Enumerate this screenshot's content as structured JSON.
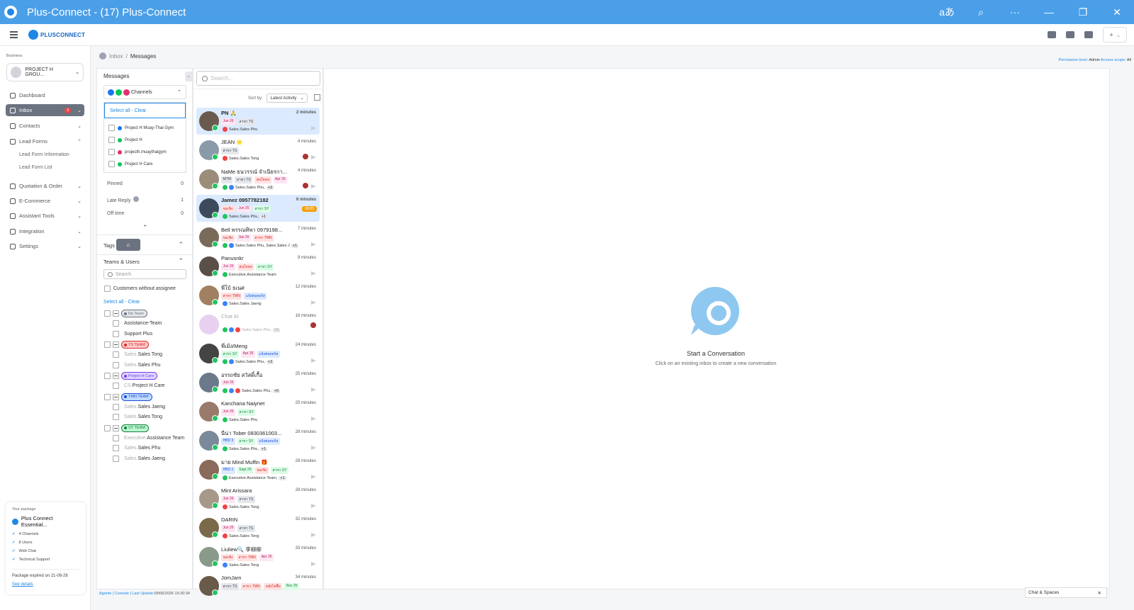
{
  "window": {
    "title": "Plus-Connect - (17) Plus-Connect",
    "controls": [
      "aあ",
      "⌕",
      "···",
      "—",
      "❐",
      "✕"
    ]
  },
  "brand": "PLUSCONNECT",
  "sidebar": {
    "business_label": "Business",
    "business": "PROJECT H GROU...",
    "nav": [
      {
        "label": "Dashboard",
        "icon": "dashboard-icon"
      },
      {
        "label": "Inbox",
        "badge": "3",
        "active": true,
        "icon": "inbox-icon"
      },
      {
        "label": "Contacts",
        "icon": "contacts-icon"
      },
      {
        "label": "Lead Forms",
        "icon": "lead-forms-icon"
      },
      {
        "label": "Quotation & Order",
        "icon": "quotation-icon"
      },
      {
        "label": "E-Commerce",
        "icon": "cart-icon"
      },
      {
        "label": "Assistant Tools",
        "icon": "assistant-icon"
      },
      {
        "label": "Integration",
        "icon": "integration-icon"
      },
      {
        "label": "Settings",
        "icon": "settings-icon"
      }
    ],
    "lead_forms_sub": [
      "Lead Form Information",
      "Lead Form List"
    ],
    "package": {
      "title": "Your package",
      "name": "Plus Connect Essential...",
      "features": [
        "4 Channels",
        "8 Users",
        "Web Chat",
        "Technical Support"
      ],
      "expiry": "Package expired on 21-08-26",
      "link": "See details"
    }
  },
  "breadcrumb": {
    "root": "Inbox",
    "current": "Messages"
  },
  "permission": {
    "label1": "Permission level:",
    "value1": "Admin",
    "label2": "Access scope:",
    "value2": "All"
  },
  "filters": {
    "title": "Messages",
    "channels_label": "Channels",
    "select_all": "Select all - Clear",
    "channels": [
      {
        "name": "Project H Muay-Thai Gym",
        "color": "#1877f2"
      },
      {
        "name": "Project H",
        "color": "#06c755"
      },
      {
        "name": "projecth.muaythaigym",
        "color": "#e1306c"
      },
      {
        "name": "Project H Care",
        "color": "#06c755"
      }
    ],
    "stats": [
      {
        "label": "Pinned",
        "value": "0"
      },
      {
        "label": "Late Reply",
        "value": "1"
      },
      {
        "label": "Off time",
        "value": "0"
      }
    ],
    "tags_label": "Tags",
    "teams_label": "Teams & Users",
    "search_placeholder": "Search",
    "without_assignee": "Customers without assignee",
    "select_all2": "Select all - Clear",
    "teams": [
      {
        "team": "No Team",
        "color": "#6b7280",
        "bg": "#e5e7eb",
        "users": [
          {
            "p": "",
            "n": "Assistance-Team"
          },
          {
            "p": "",
            "n": "Support Plus"
          }
        ]
      },
      {
        "team": "TS TEAM",
        "color": "#dc2626",
        "bg": "#fecaca",
        "users": [
          {
            "p": "Sales.",
            "n": "Sales Tong"
          },
          {
            "p": "Sales.",
            "n": "Sales Phu"
          }
        ]
      },
      {
        "team": "Project H Care",
        "color": "#7c3aed",
        "bg": "#ddd6fe",
        "users": [
          {
            "p": "CS.",
            "n": "Project H Care"
          }
        ]
      },
      {
        "team": "TMN TEAM",
        "color": "#1d4ed8",
        "bg": "#bfdbfe",
        "users": [
          {
            "p": "Sales.",
            "n": "Sales Jaeng"
          },
          {
            "p": "Sales.",
            "n": "Sales Tong"
          }
        ]
      },
      {
        "team": "SY TEAM",
        "color": "#15803d",
        "bg": "#bbf7d0",
        "users": [
          {
            "p": "Executive.",
            "n": "Assistance Team"
          },
          {
            "p": "Sales.",
            "n": "Sales Phu"
          },
          {
            "p": "Sales.",
            "n": "Sales Jaeng"
          }
        ]
      }
    ]
  },
  "list": {
    "search_placeholder": "Search...",
    "sort_label": "Sort by:",
    "sort_value": "Latest Activity",
    "conversations": [
      {
        "name": "PN 🙏",
        "time": "2 minutes",
        "tags": [
          [
            "Jun 26",
            "#fce7f3",
            "#be185d"
          ],
          [
            "สาขา TS",
            "#e5e7eb",
            "#374151"
          ]
        ],
        "assignee": "Sales.Sales Phu",
        "dots": [
          "#ef4444"
        ],
        "hl": true,
        "bold": true
      },
      {
        "name": "JEAN 🌟",
        "time": "4 minutes",
        "tags": [
          [
            "สาขา TS",
            "#e5e7eb",
            "#374151"
          ]
        ],
        "assignee": "Sales.Sales Tong",
        "dots": [
          "#ef4444"
        ],
        "uav": true
      },
      {
        "name": "NaMe ธนวรรณ์ จำเนียรกา...",
        "time": "4 minutes",
        "tags": [
          [
            "MTM",
            "#e5e7eb",
            "#374151"
          ],
          [
            "สาขา TS",
            "#e5e7eb",
            "#374151"
          ],
          [
            "สนใจคล",
            "#fee2e2",
            "#dc2626"
          ],
          [
            "Apr 26",
            "#fce7f3",
            "#be185d"
          ]
        ],
        "assignee": "Sales.Sales Phu,",
        "more": "+3",
        "dots": [
          "#22c55e",
          "#3b82f6"
        ],
        "uav": true
      },
      {
        "name": "Jamez 0957782182",
        "time": "6 minutes",
        "tags": [
          [
            "ขอเชิง",
            "#fee2e2",
            "#dc2626"
          ],
          [
            "Jun 26",
            "#fce7f3",
            "#be185d"
          ],
          [
            "สาขา SY",
            "#dcfce7",
            "#15803d"
          ]
        ],
        "assignee": "Sales.Sales Phu,",
        "more": "+1",
        "dots": [
          "#22c55e"
        ],
        "hl": true,
        "bold": true,
        "late": "00:05"
      },
      {
        "name": "Bell พรรณทิพา 0979198...",
        "time": "7 minutes",
        "tags": [
          [
            "ขอเชิง",
            "#fee2e2",
            "#dc2626"
          ],
          [
            "Jan 26",
            "#fce7f3",
            "#be185d"
          ],
          [
            "สาขา TMN",
            "#fee2e2",
            "#dc2626"
          ]
        ],
        "assignee": "Sales.Sales Phu, Sales.Sales J",
        "more": "+1",
        "dots": [
          "#22c55e",
          "#3b82f6"
        ]
      },
      {
        "name": "Panusnkr",
        "time": "9 minutes",
        "tags": [
          [
            "Jun 26",
            "#fce7f3",
            "#be185d"
          ],
          [
            "สนใจคล",
            "#fee2e2",
            "#dc2626"
          ],
          [
            "สาขา SY",
            "#dcfce7",
            "#15803d"
          ]
        ],
        "assignee": "Executive.Assistance Team",
        "dots": [
          "#22c55e"
        ]
      },
      {
        "name": "พี่โบ้ ธเนศ",
        "time": "12 minutes",
        "tags": [
          [
            "สาขา TMN",
            "#fee2e2",
            "#dc2626"
          ],
          [
            "แจ้งต่อคอร์ส",
            "#dbeafe",
            "#1d4ed8"
          ]
        ],
        "assignee": "Sales.Sales Jaeng",
        "dots": [
          "#3b82f6"
        ]
      },
      {
        "name": "Chat AI",
        "time": "16 minutes",
        "tags": [],
        "assignee": "Sales.Sales Phu,",
        "more": "+5",
        "dots": [
          "#22c55e",
          "#3b82f6",
          "#ef4444"
        ],
        "dim": true,
        "uav": true
      },
      {
        "name": "พี่เม้ง/Meng",
        "time": "24 minutes",
        "tags": [
          [
            "สาขา SY",
            "#dcfce7",
            "#15803d"
          ],
          [
            "Apr 26",
            "#fce7f3",
            "#be185d"
          ],
          [
            "แจ้งต่อคอร์ส",
            "#dbeafe",
            "#1d4ed8"
          ]
        ],
        "assignee": "Sales.Sales Phu,",
        "more": "+3",
        "dots": [
          "#22c55e",
          "#3b82f6"
        ]
      },
      {
        "name": "อรรถชัย สวัสดิ์เกื้อ",
        "time": "25 minutes",
        "tags": [
          [
            "Jun 26",
            "#fce7f3",
            "#be185d"
          ]
        ],
        "assignee": "Sales.Sales Phu,",
        "more": "+5",
        "dots": [
          "#22c55e",
          "#3b82f6",
          "#ef4444"
        ]
      },
      {
        "name": "Kanchana Naiynet",
        "time": "25 minutes",
        "tags": [
          [
            "Jun 26",
            "#fce7f3",
            "#be185d"
          ],
          [
            "สาขา SY",
            "#dcfce7",
            "#15803d"
          ]
        ],
        "assignee": "Sales.Sales Phu",
        "dots": [
          "#22c55e"
        ]
      },
      {
        "name": "นีน่า Tober 0830361003...",
        "time": "28 minutes",
        "tags": [
          [
            "HBD 3",
            "#dbeafe",
            "#1d4ed8"
          ],
          [
            "สาขา SY",
            "#dcfce7",
            "#15803d"
          ],
          [
            "แจ้งต่อคอร์ส",
            "#dbeafe",
            "#1d4ed8"
          ]
        ],
        "assignee": "Sales.Sales Phu,",
        "more": "+1",
        "dots": [
          "#22c55e"
        ]
      },
      {
        "name": "มาย Mind Muffin 🎁",
        "time": "28 minutes",
        "tags": [
          [
            "HBD 1",
            "#dbeafe",
            "#1d4ed8"
          ],
          [
            "Sept 25",
            "#dcfce7",
            "#15803d"
          ],
          [
            "ขอเชิง",
            "#fee2e2",
            "#dc2626"
          ],
          [
            "สาขา SY",
            "#dcfce7",
            "#15803d"
          ]
        ],
        "assignee": "Executive.Assistance Team,",
        "more": "+1",
        "dots": [
          "#22c55e"
        ]
      },
      {
        "name": "Mint Arissara",
        "time": "28 minutes",
        "tags": [
          [
            "Jun 26",
            "#fce7f3",
            "#be185d"
          ],
          [
            "สาขา TS",
            "#e5e7eb",
            "#374151"
          ]
        ],
        "assignee": "Sales.Sales Tong",
        "dots": [
          "#ef4444"
        ]
      },
      {
        "name": "DARIN",
        "time": "32 minutes",
        "tags": [
          [
            "Jun 26",
            "#fce7f3",
            "#be185d"
          ],
          [
            "สาขา TS",
            "#e5e7eb",
            "#374151"
          ]
        ],
        "assignee": "Sales.Sales Tong",
        "dots": [
          "#ef4444"
        ]
      },
      {
        "name": "Liuliew🔍 李柳柳",
        "time": "33 minutes",
        "tags": [
          [
            "ขอเชิง",
            "#fee2e2",
            "#dc2626"
          ],
          [
            "สาขา TMN",
            "#fee2e2",
            "#dc2626"
          ],
          [
            "Apr 26",
            "#fce7f3",
            "#be185d"
          ]
        ],
        "assignee": "Sales.Sales Tong",
        "dots": [
          "#3b82f6"
        ]
      },
      {
        "name": "JomJam",
        "time": "34 minutes",
        "tags": [
          [
            "สาขา TS",
            "#e5e7eb",
            "#374151"
          ],
          [
            "สาขา TMN",
            "#fee2e2",
            "#dc2626"
          ],
          [
            "หลังไม่ซื้อ",
            "#fee2e2",
            "#dc2626"
          ],
          [
            "Nov 25",
            "#dcfce7",
            "#15803d"
          ]
        ],
        "assignee": "",
        "dots": []
      }
    ]
  },
  "empty": {
    "title": "Start a Conversation",
    "subtitle": "Click on an existing inbox to create a new conversation"
  },
  "footer": {
    "links": "Agents | Console | Last Update:",
    "time": "09/06/2026 15:30:34"
  },
  "chat_spaces": {
    "label": "Chat & Spaces",
    "close": "✕"
  }
}
